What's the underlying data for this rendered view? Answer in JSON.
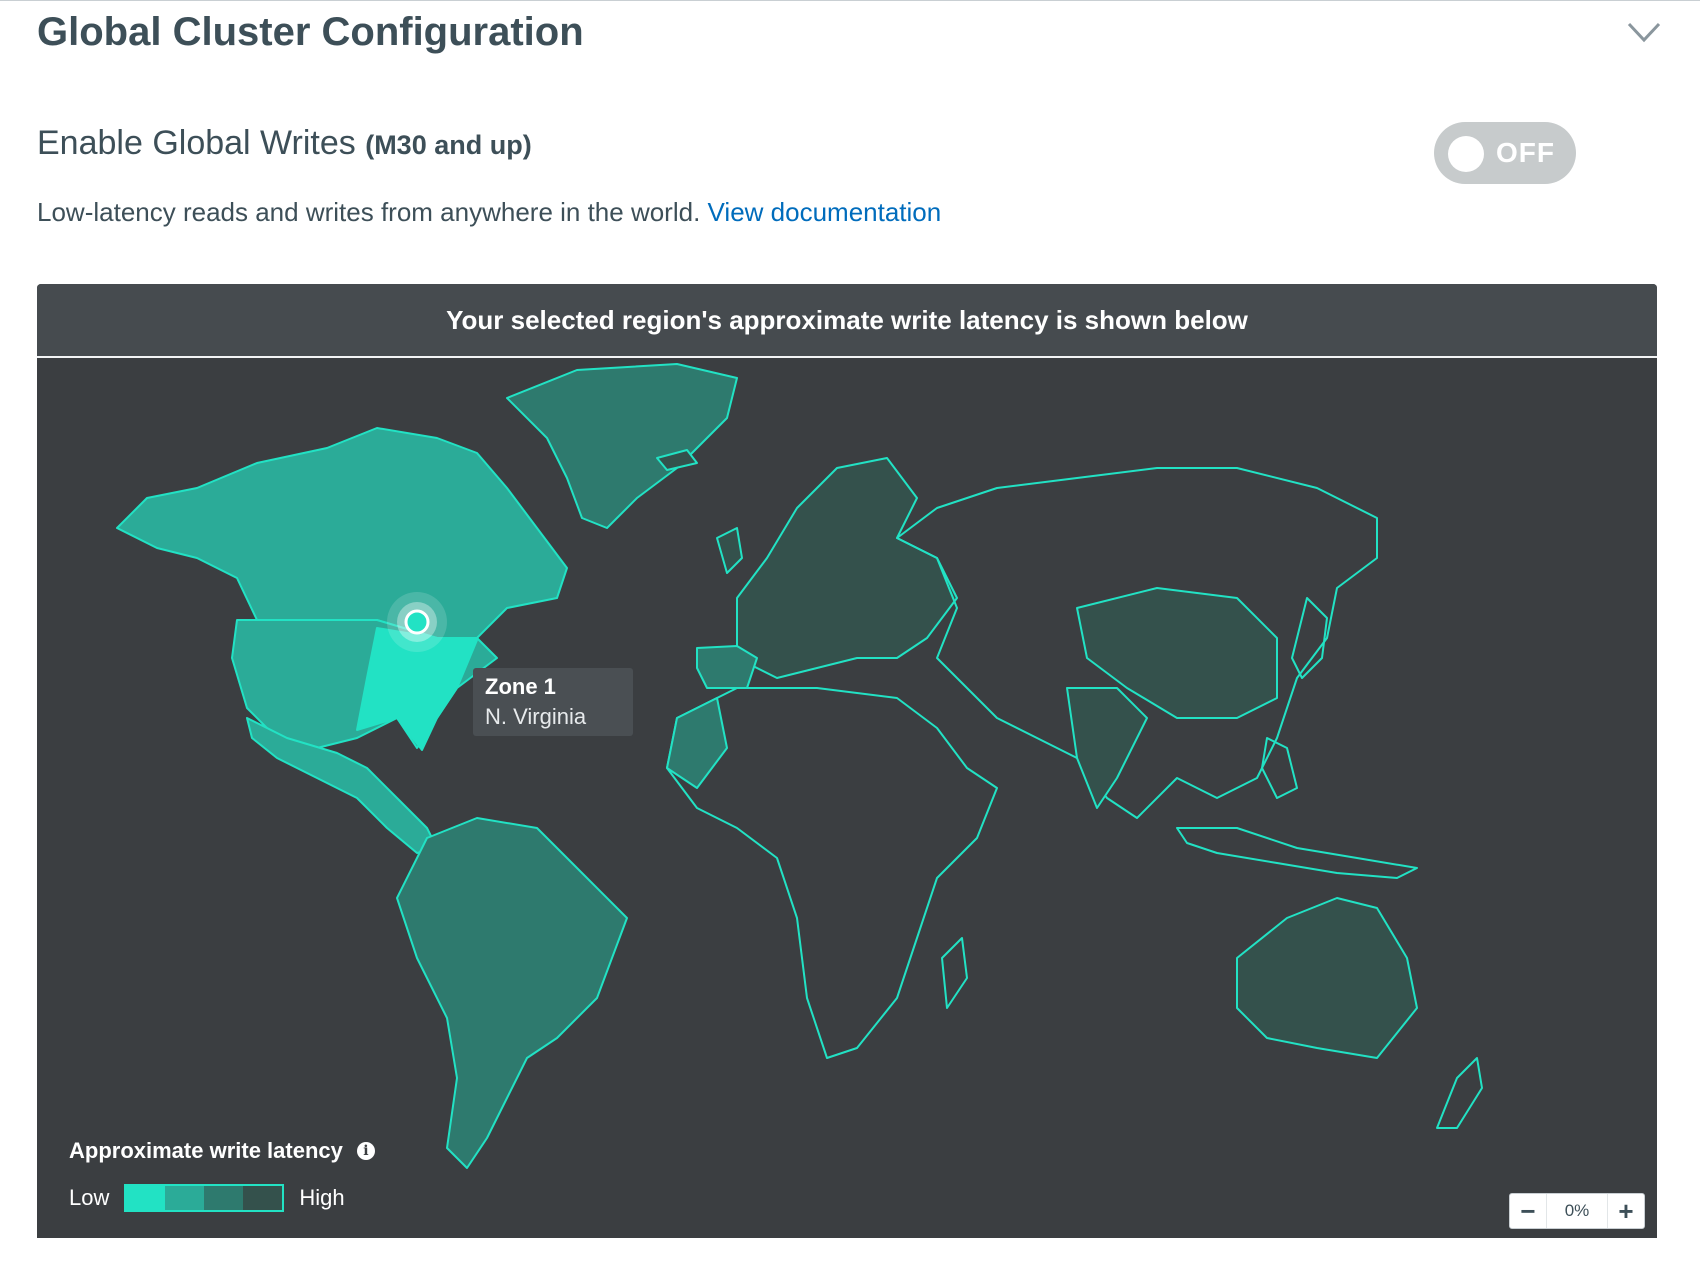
{
  "section": {
    "title": "Global Cluster Configuration"
  },
  "global_writes": {
    "title": "Enable Global Writes",
    "subtitle": "(M30 and up)",
    "toggle_state": "OFF",
    "description": "Low-latency reads and writes from anywhere in the world.",
    "doc_link": "View documentation"
  },
  "map": {
    "header": "Your selected region's approximate write latency is shown below",
    "zone": {
      "name": "Zone 1",
      "region": "N. Virginia"
    },
    "legend": {
      "title": "Approximate write latency",
      "low": "Low",
      "high": "High"
    },
    "zoom": {
      "value": "0%"
    },
    "colors": {
      "background": "#3b3e41",
      "header_background": "#464b4f",
      "accent": "#22e2c4",
      "latency_scale": [
        "#22e2c4",
        "#2bab98",
        "#2e7a6e",
        "#34514c"
      ]
    },
    "icons": [
      "chevron-down-icon",
      "info-icon",
      "minus-icon",
      "plus-icon"
    ]
  }
}
